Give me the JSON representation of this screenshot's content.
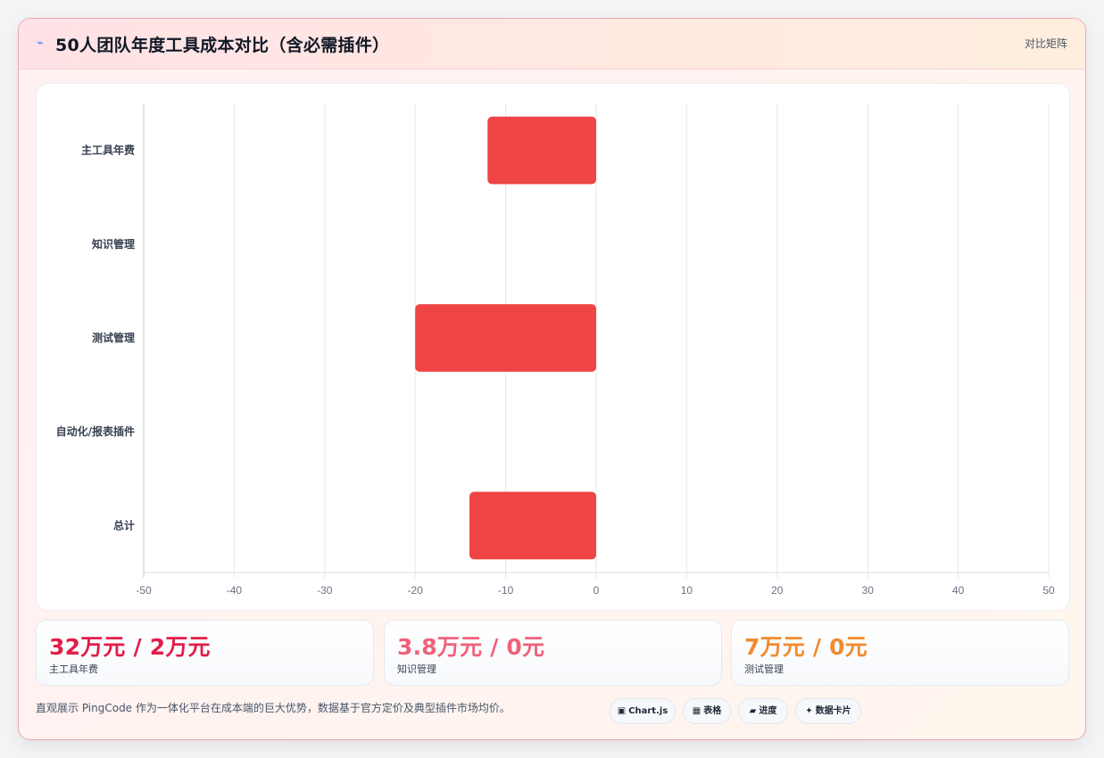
{
  "header": {
    "icon": "lightning-icon",
    "title": "50人团队年度工具成本对比（含必需插件）",
    "tag": "对比矩阵"
  },
  "colors": {
    "bar": "#ef4444",
    "kpi_1": "#e11d48",
    "kpi_2": "#f0607a",
    "kpi_3": "#f28a2e"
  },
  "chart_data": {
    "type": "bar",
    "orientation": "horizontal",
    "categories": [
      "主工具年费",
      "知识管理",
      "测试管理",
      "自动化/报表插件",
      "总计"
    ],
    "values": [
      -12,
      0,
      -20,
      0,
      -14
    ],
    "xlim": [
      -50,
      50
    ],
    "xticks": [
      "-50",
      "-40",
      "-30",
      "-20",
      "-10",
      "0",
      "10",
      "20",
      "30",
      "40",
      "50"
    ],
    "grid": true,
    "legend": "none"
  },
  "kpis": [
    {
      "value": "32万元 / 2万元",
      "label": "主工具年费"
    },
    {
      "value": "3.8万元 / 0元",
      "label": "知识管理"
    },
    {
      "value": "7万元 / 0元",
      "label": "测试管理"
    }
  ],
  "footer": {
    "text": "直观展示 PingCode 作为一体化平台在成本端的巨大优势，数据基于官方定价及典型插件市场均价。",
    "pills": [
      {
        "icon": "chart-icon",
        "glyph": "▣",
        "label": "Chart.js"
      },
      {
        "icon": "table-icon",
        "glyph": "▦",
        "label": "表格"
      },
      {
        "icon": "progress-icon",
        "glyph": "▰",
        "label": "进度"
      },
      {
        "icon": "sparkle-icon",
        "glyph": "✦",
        "label": "数据卡片"
      }
    ]
  }
}
